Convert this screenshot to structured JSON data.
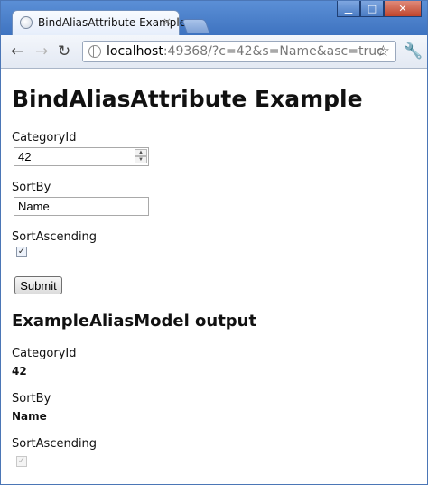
{
  "browser": {
    "tab_title": "BindAliasAttribute Example",
    "tab_close": "×",
    "url_host": "localhost",
    "url_rest": ":49368/?c=42&s=Name&asc=true",
    "icons": [
      "back-arrow-icon",
      "forward-arrow-icon",
      "reload-icon",
      "globe-icon",
      "star-icon",
      "wrench-icon"
    ]
  },
  "page": {
    "heading": "BindAliasAttribute Example",
    "form": {
      "category_label": "CategoryId",
      "category_value": "42",
      "sortby_label": "SortBy",
      "sortby_value": "Name",
      "sortasc_label": "SortAscending",
      "sortasc_checked": true,
      "submit_label": "Submit"
    },
    "output": {
      "heading": "ExampleAliasModel output",
      "category_label": "CategoryId",
      "category_value": "42",
      "sortby_label": "SortBy",
      "sortby_value": "Name",
      "sortasc_label": "SortAscending",
      "sortasc_checked": true
    }
  }
}
